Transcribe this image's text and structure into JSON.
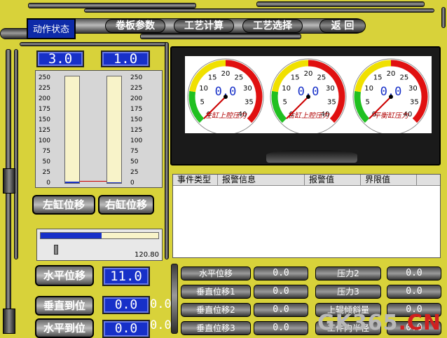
{
  "nav": {
    "action_state": "动作状态",
    "items": [
      "卷板参数",
      "工艺计算",
      "工艺选择",
      "返 回"
    ]
  },
  "cylinders": {
    "left_value": "3.0",
    "right_value": "1.0",
    "scale": [
      "250",
      "225",
      "200",
      "175",
      "150",
      "125",
      "100",
      "75",
      "50",
      "25",
      "0"
    ],
    "left_button": "左缸位移",
    "right_button": "右缸位移"
  },
  "gauges": [
    {
      "label": "左缸上腔压力",
      "value": "0.0",
      "ticks": [
        "0",
        "5",
        "10",
        "15",
        "20",
        "25",
        "30",
        "35",
        "40"
      ]
    },
    {
      "label": "右缸上腔压力",
      "value": "0.0",
      "ticks": [
        "0",
        "5",
        "10",
        "15",
        "20",
        "25",
        "30",
        "35",
        "40"
      ]
    },
    {
      "label": "平衡缸压力",
      "value": "0.0",
      "ticks": [
        "0",
        "5",
        "10",
        "15",
        "20",
        "25",
        "30",
        "35",
        "40"
      ]
    }
  ],
  "alarm_table": {
    "columns": [
      "事件类型",
      "报警信息",
      "报警值",
      "界限值"
    ]
  },
  "slider": {
    "progress": 0.52,
    "value_text": "120.80"
  },
  "horizontal": {
    "button": "水平位移",
    "value": "11.0"
  },
  "vertical_arrive": {
    "button": "垂直到位",
    "value": "0.0",
    "side_value": "0.0"
  },
  "horizontal_arrive": {
    "button": "水平到位",
    "value": "0.0",
    "side_value": "0.0"
  },
  "data_rows": {
    "left": [
      {
        "label": "水平位移",
        "value": "0.0"
      },
      {
        "label": "垂直位移1",
        "value": "0.0"
      },
      {
        "label": "垂直位移2",
        "value": "0.0"
      },
      {
        "label": "垂直位移3",
        "value": "0.0"
      }
    ],
    "right": [
      {
        "label": "压力2",
        "value": "0.0"
      },
      {
        "label": "压力3",
        "value": "0.0"
      },
      {
        "label": "上辊倾斜量",
        "value": "0.0"
      },
      {
        "label": "工件内半径",
        "value": "0.0"
      }
    ]
  },
  "watermark": {
    "main": "GK365",
    "suffix": ".CN"
  }
}
